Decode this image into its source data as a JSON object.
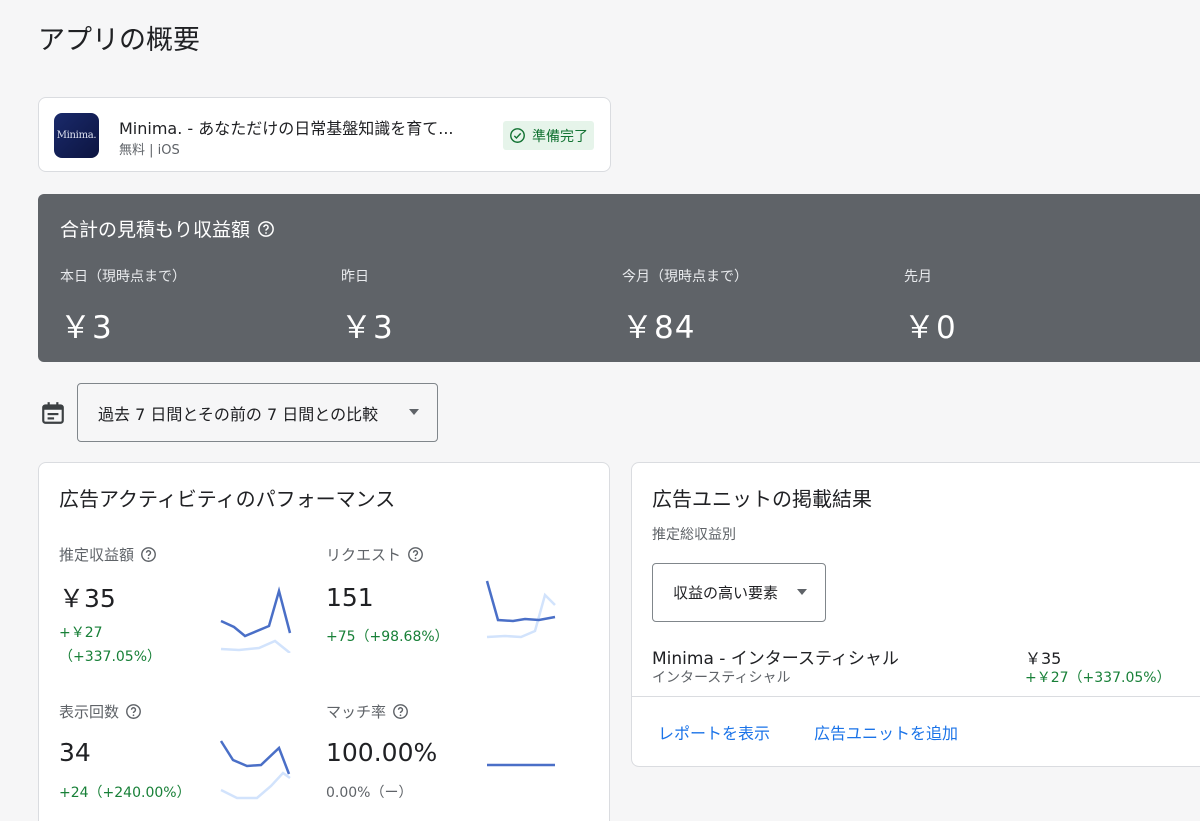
{
  "page_title": "アプリの概要",
  "app": {
    "icon_text": "Minima.",
    "name": "Minima. - あなただけの日常基盤知識を育て...",
    "meta": "無料 | iOS",
    "status": "準備完了"
  },
  "revenue": {
    "title": "合計の見積もり収益額",
    "columns": [
      {
        "label": "本日（現時点まで）",
        "value": "￥3"
      },
      {
        "label": "昨日",
        "value": "￥3"
      },
      {
        "label": "今月（現時点まで）",
        "value": "￥84"
      },
      {
        "label": "先月",
        "value": "￥0"
      }
    ]
  },
  "date_range": {
    "selected": "過去 7 日間とその前の 7 日間との比較"
  },
  "performance": {
    "title": "広告アクティビティのパフォーマンス",
    "metrics": [
      {
        "label": "推定収益額",
        "value": "￥35",
        "delta_line1": "+￥27",
        "delta_line2": "（+337.05%）"
      },
      {
        "label": "リクエスト",
        "value": "151",
        "delta_line1": "+75（+98.68%）",
        "delta_line2": ""
      },
      {
        "label": "表示回数",
        "value": "34",
        "delta_line1": "+24（+240.00%）",
        "delta_line2": ""
      },
      {
        "label": "マッチ率",
        "value": "100.00%",
        "delta_line1": "0.00%（ー）",
        "delta_line2": ""
      }
    ]
  },
  "ad_units": {
    "title": "広告ユニットの掲載結果",
    "subtitle": "推定総収益別",
    "sort_selected": "収益の高い要素",
    "rows": [
      {
        "name": "Minima - インタースティシャル",
        "type": "インタースティシャル",
        "value": "￥35",
        "delta": "+￥27（+337.05%）"
      }
    ],
    "links": {
      "report": "レポートを表示",
      "add_unit": "広告ユニットを追加"
    }
  },
  "colors": {
    "accent_blue": "#1a73e8",
    "positive_green": "#188038",
    "revenue_card_bg": "#5f6368",
    "spark_primary": "#4a6fc7",
    "spark_secondary": "#d2e3fc"
  }
}
